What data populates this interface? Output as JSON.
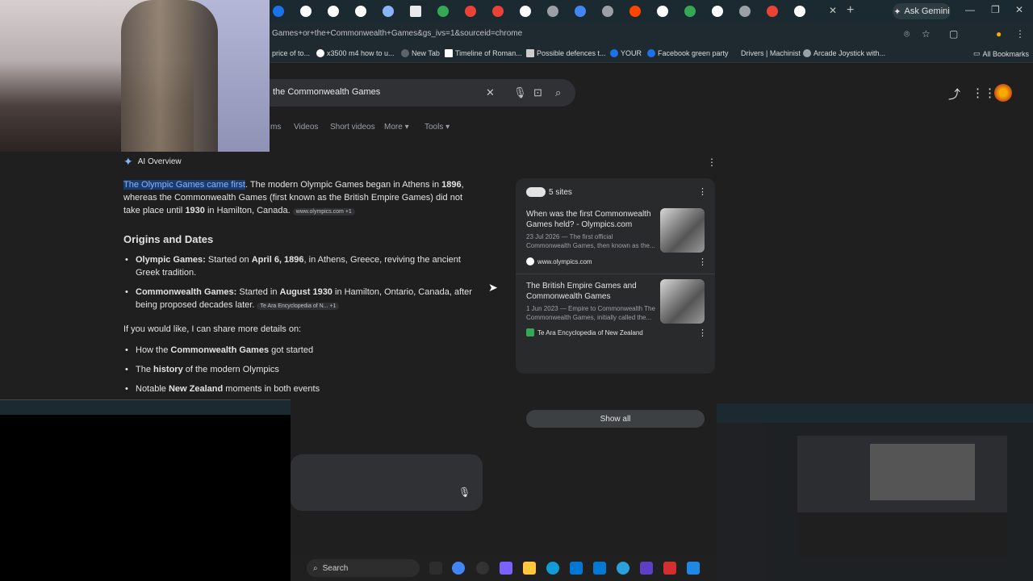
{
  "browser": {
    "ask_gemini_label": "Ask Gemini",
    "url": "Games+or+the+Commonwealth+Games&gs_ivs=1&sourceid=chrome",
    "bookmarks": [
      "price of to...",
      "x3500 m4 how to u...",
      "New Tab",
      "Timeline of Roman...",
      "Possible defences t...",
      "YOUR",
      "Facebook green party",
      "Drivers | Machinist",
      "Arcade Joystick with..."
    ],
    "all_bookmarks_label": "All Bookmarks"
  },
  "search": {
    "query": "the Commonwealth Games",
    "tabs": [
      "ms",
      "Videos",
      "Short videos",
      "More",
      "Tools"
    ]
  },
  "ai_overview": {
    "label": "AI Overview",
    "intro_highlight": "The Olympic Games came first",
    "intro_rest_1": ". The modern Olympic Games began in Athens in ",
    "intro_year_1": "1896",
    "intro_rest_2": ", whereas the Commonwealth Games (first known as the British Empire Games) did not take place until ",
    "intro_year_2": "1930",
    "intro_rest_3": " in Hamilton, Canada.",
    "intro_cite": "www.olympics.com +1",
    "section_heading": "Origins and Dates",
    "origins": [
      {
        "bold": "Olympic Games:",
        "text_a": " Started on ",
        "bold2": "April 6, 1896",
        "text_b": ", in Athens, Greece, reviving the ancient Greek tradition."
      },
      {
        "bold": "Commonwealth Games:",
        "text_a": " Started in ",
        "bold2": "August 1930",
        "text_b": " in Hamilton, Ontario, Canada, after being proposed decades later.",
        "cite": "Te Ara Encyclopedia of N... +1"
      }
    ],
    "share_prompt": "If you would like, I can share more details on:",
    "more_items": [
      {
        "pre": "How the ",
        "bold": "Commonwealth Games",
        "post": " got started"
      },
      {
        "pre": "The ",
        "bold": "history",
        "post": " of the modern Olympics"
      },
      {
        "pre": "Notable ",
        "bold": "New Zealand",
        "post": " moments in both events"
      }
    ]
  },
  "sources": {
    "count_label": "5 sites",
    "items": [
      {
        "title": "When was the first Commonwealth Games held? - Olympics.com",
        "date": "23 Jul 2026 — The first official Commonwealth Games, then known as the...",
        "site": "www.olympics.com"
      },
      {
        "title": "The British Empire Games and Commonwealth Games",
        "date": "1 Jun 2023 — Empire to Commonwealth The Commonwealth Games, initially called the...",
        "site": "Te Ara Encyclopedia of New Zealand"
      }
    ],
    "show_all": "Show all"
  },
  "taskbar": {
    "search_label": "Search"
  }
}
